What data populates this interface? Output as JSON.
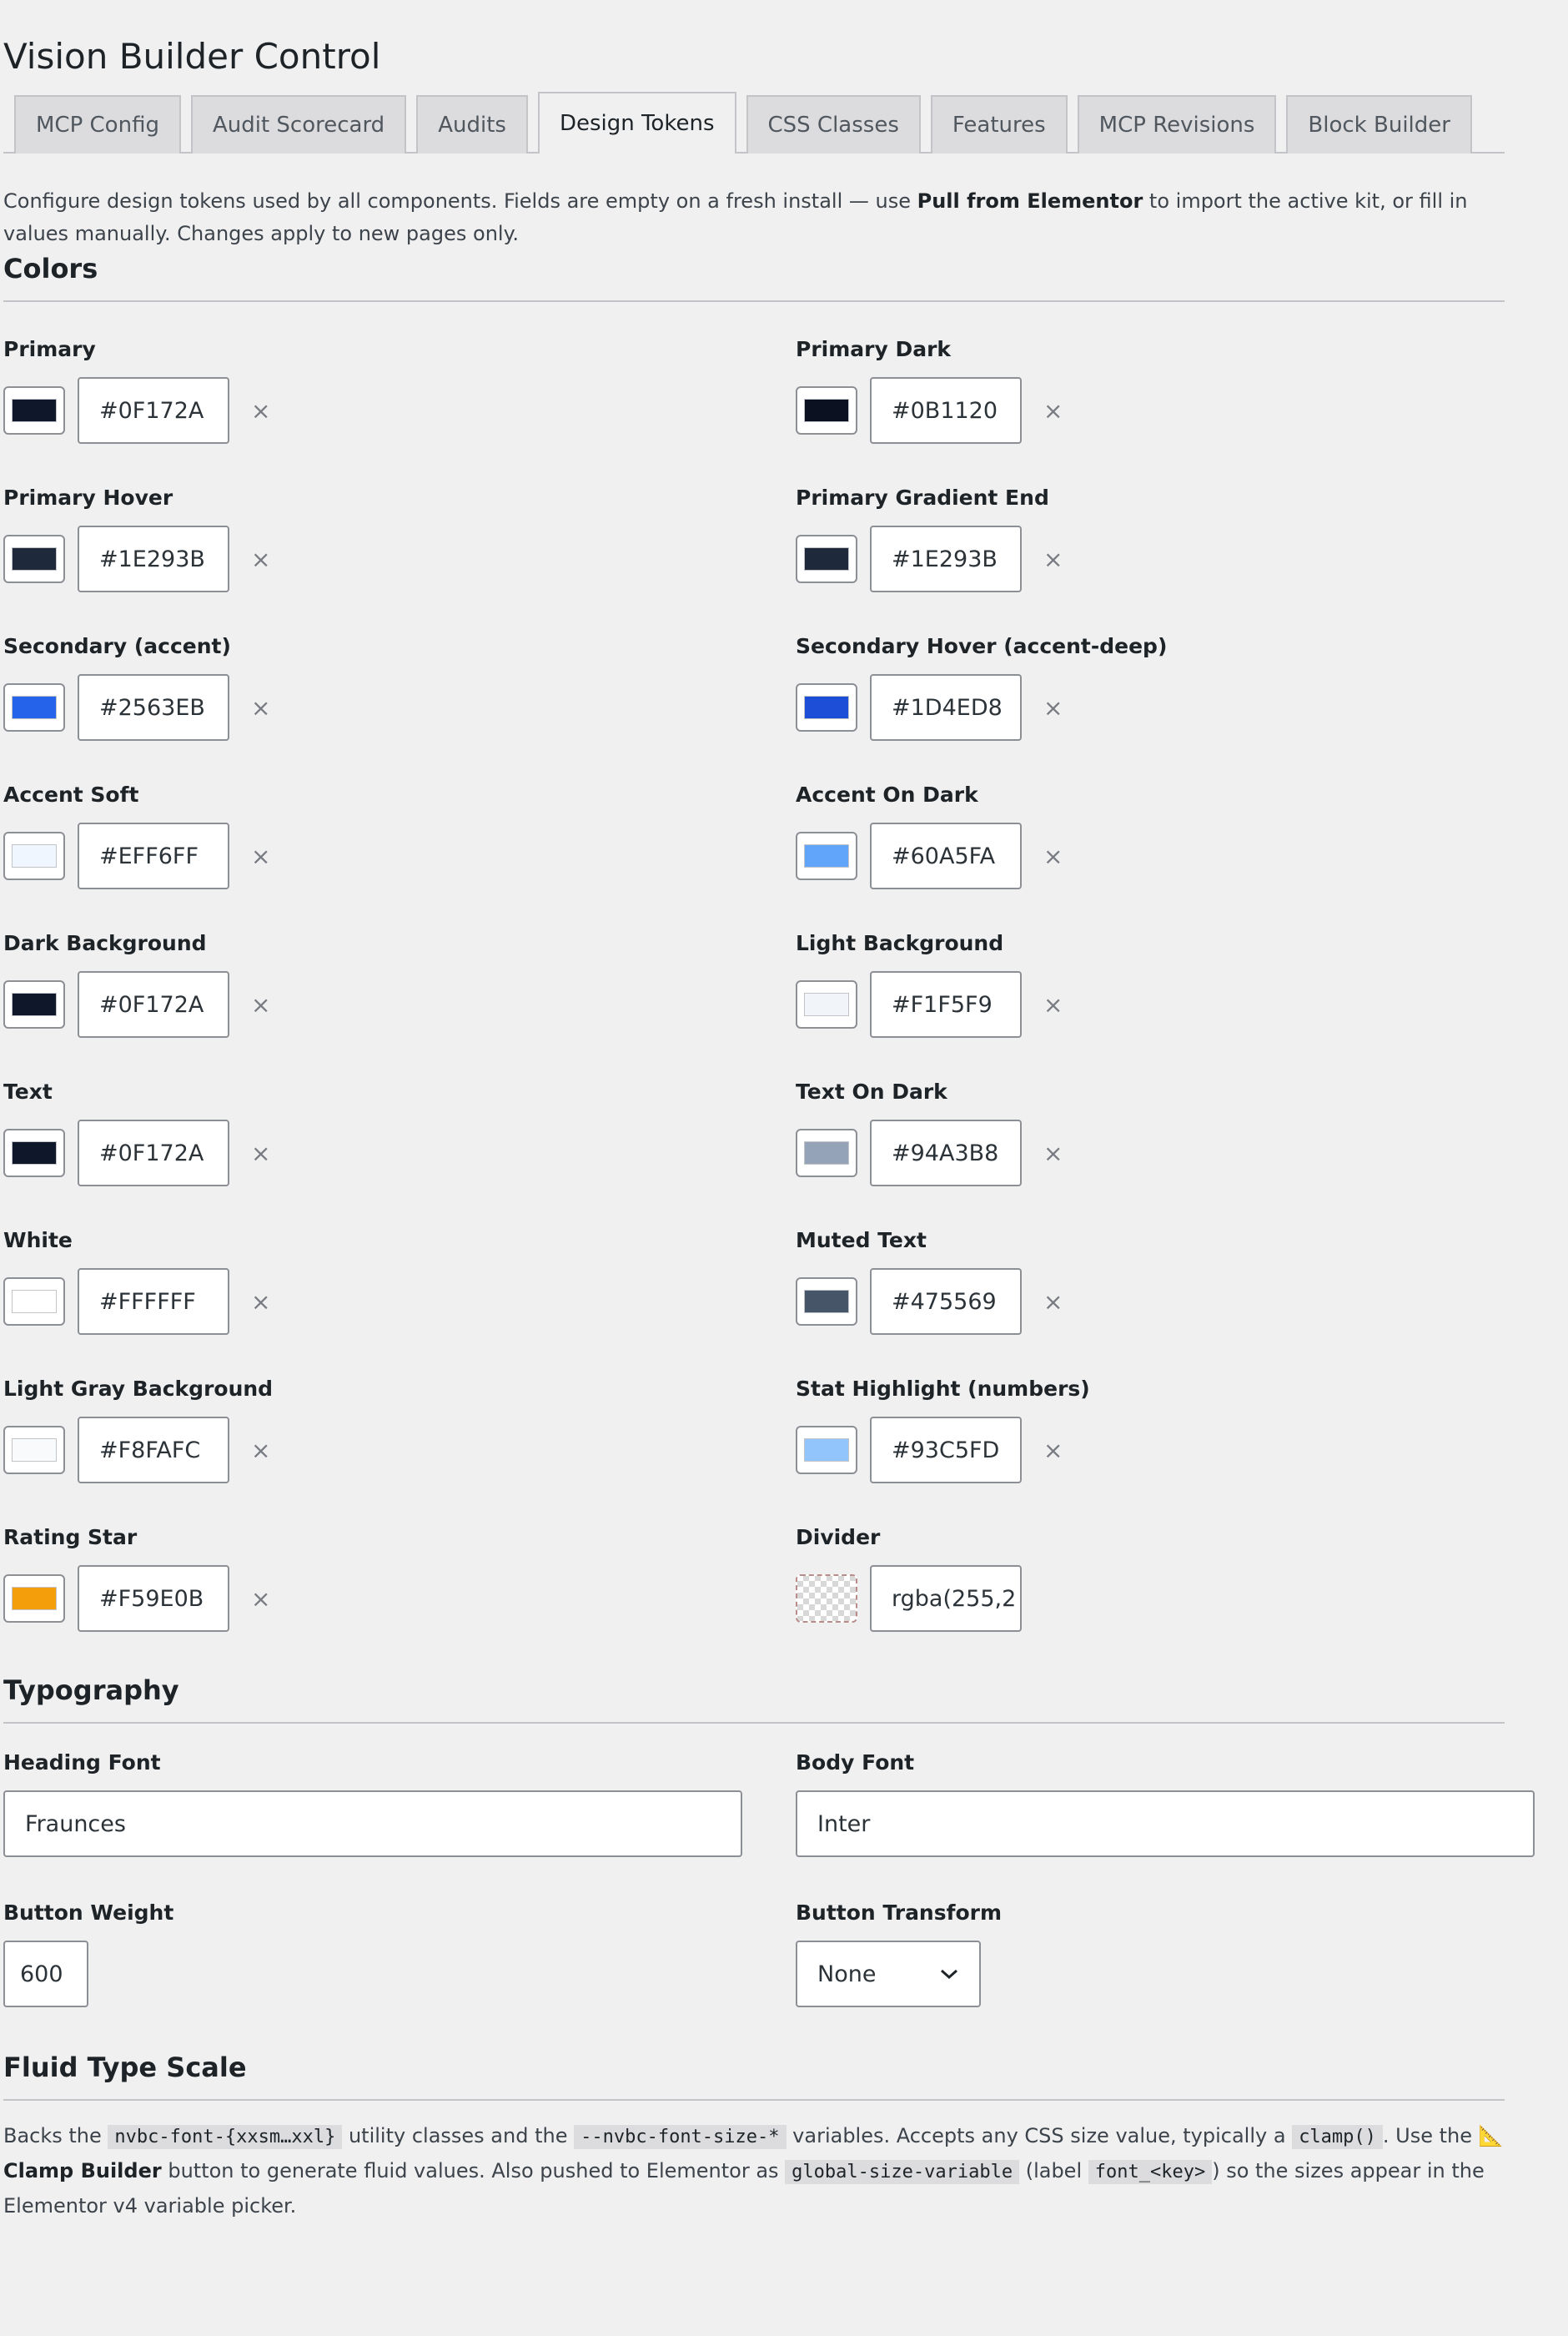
{
  "page": {
    "title": "Vision Builder Control"
  },
  "tabs": [
    {
      "label": "MCP Config",
      "active": false
    },
    {
      "label": "Audit Scorecard",
      "active": false
    },
    {
      "label": "Audits",
      "active": false
    },
    {
      "label": "Design Tokens",
      "active": true
    },
    {
      "label": "CSS Classes",
      "active": false
    },
    {
      "label": "Features",
      "active": false
    },
    {
      "label": "MCP Revisions",
      "active": false
    },
    {
      "label": "Block Builder",
      "active": false
    }
  ],
  "intro": {
    "before": "Configure design tokens used by all components. Fields are empty on a fresh install — use ",
    "bold": "Pull from Elementor",
    "after": " to import the active kit, or fill in values manually. Changes apply to new pages only."
  },
  "colors": {
    "heading": "Colors",
    "clear_glyph": "×",
    "fields": [
      {
        "label": "Primary",
        "value": "#0F172A",
        "swatch": "#0F172A"
      },
      {
        "label": "Primary Dark",
        "value": "#0B1120",
        "swatch": "#0B1120"
      },
      {
        "label": "Primary Hover",
        "value": "#1E293B",
        "swatch": "#1E293B"
      },
      {
        "label": "Primary Gradient End",
        "value": "#1E293B",
        "swatch": "#1E293B"
      },
      {
        "label": "Secondary (accent)",
        "value": "#2563EB",
        "swatch": "#2563EB"
      },
      {
        "label": "Secondary Hover (accent-deep)",
        "value": "#1D4ED8",
        "swatch": "#1D4ED8"
      },
      {
        "label": "Accent Soft",
        "value": "#EFF6FF",
        "swatch": "#EFF6FF"
      },
      {
        "label": "Accent On Dark",
        "value": "#60A5FA",
        "swatch": "#60A5FA"
      },
      {
        "label": "Dark Background",
        "value": "#0F172A",
        "swatch": "#0F172A"
      },
      {
        "label": "Light Background",
        "value": "#F1F5F9",
        "swatch": "#F1F5F9"
      },
      {
        "label": "Text",
        "value": "#0F172A",
        "swatch": "#0F172A"
      },
      {
        "label": "Text On Dark",
        "value": "#94A3B8",
        "swatch": "#94A3B8"
      },
      {
        "label": "White",
        "value": "#FFFFFF",
        "swatch": "#FFFFFF"
      },
      {
        "label": "Muted Text",
        "value": "#475569",
        "swatch": "#475569"
      },
      {
        "label": "Light Gray Background",
        "value": "#F8FAFC",
        "swatch": "#F8FAFC"
      },
      {
        "label": "Stat Highlight (numbers)",
        "value": "#93C5FD",
        "swatch": "#93C5FD"
      },
      {
        "label": "Rating Star",
        "value": "#F59E0B",
        "swatch": "#F59E0B"
      },
      {
        "label": "Divider",
        "value": "rgba(255,2",
        "swatch": "transparent"
      }
    ]
  },
  "typography": {
    "heading": "Typography",
    "heading_font": {
      "label": "Heading Font",
      "value": "Fraunces"
    },
    "body_font": {
      "label": "Body Font",
      "value": "Inter"
    },
    "button_weight": {
      "label": "Button Weight",
      "value": "600"
    },
    "button_transform": {
      "label": "Button Transform",
      "value": "None"
    }
  },
  "fluid": {
    "heading": "Fluid Type Scale",
    "t1": "Backs the ",
    "c1": "nvbc-font-{xxsm…xxl}",
    "t2": " utility classes and the ",
    "c2": "--nvbc-font-size-*",
    "t3": " variables. Accepts any CSS size value, typically a ",
    "c3": "clamp()",
    "t4": ". Use the ",
    "icon": "📐",
    "b1": "Clamp Builder",
    "t5": " button to generate fluid values. Also pushed to Elementor as ",
    "c4": "global-size-variable",
    "t6": " (label ",
    "c5": "font_<key>",
    "t7": ") so the sizes appear in the Elementor v4 variable picker."
  }
}
